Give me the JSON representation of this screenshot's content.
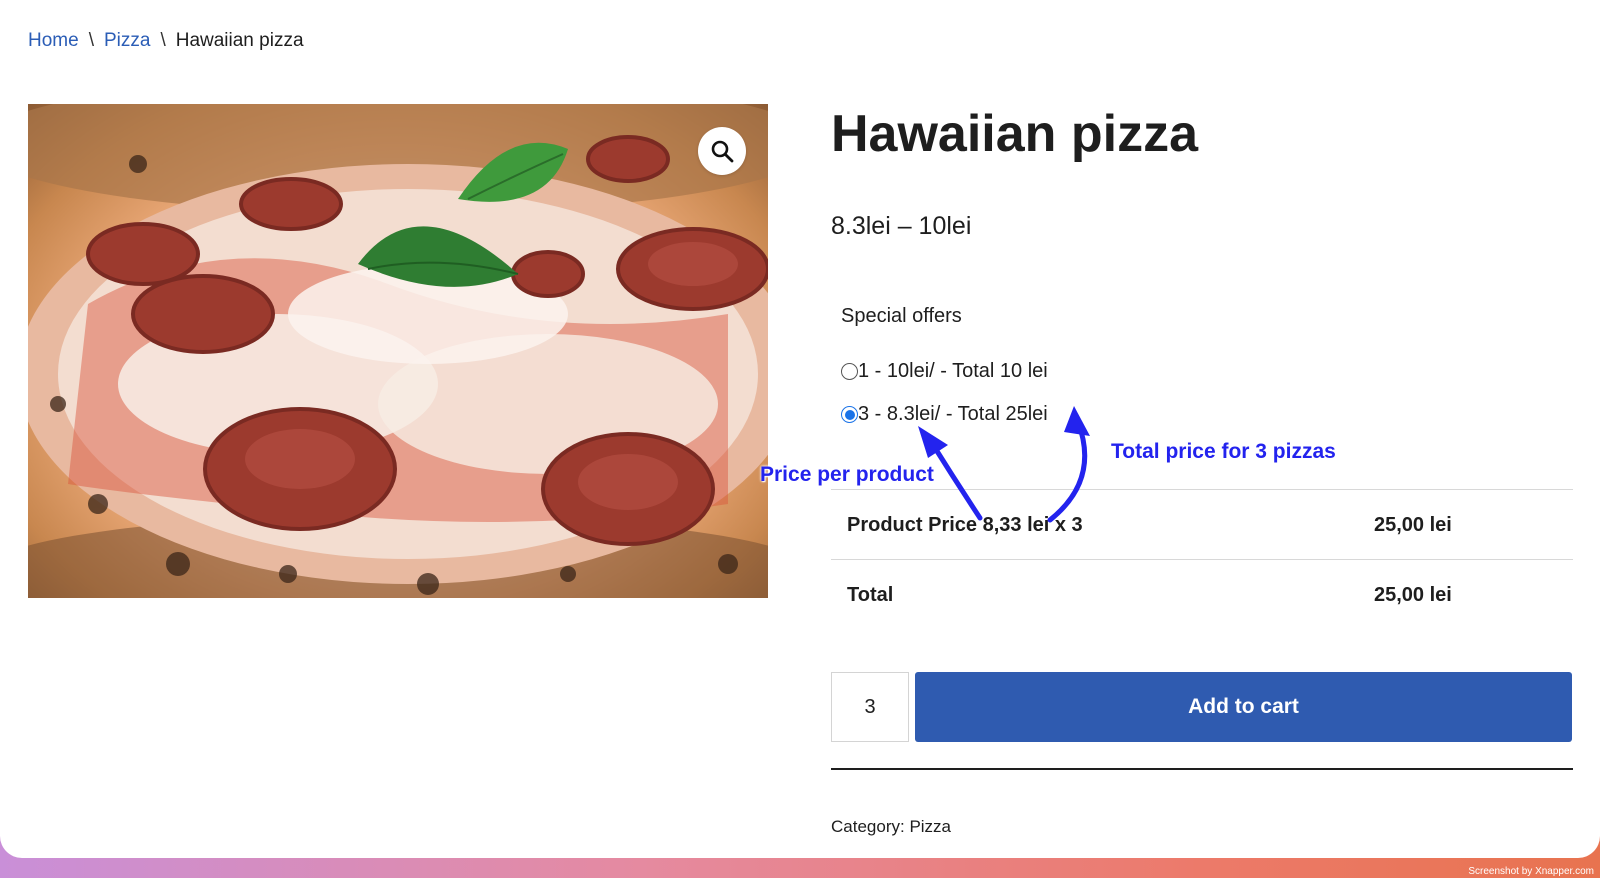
{
  "breadcrumb": {
    "home": "Home",
    "category": "Pizza",
    "current": "Hawaiian pizza",
    "separator": "\\"
  },
  "product": {
    "title": "Hawaiian pizza",
    "price_range": "8.3lei – 10lei",
    "image_alt_icon": "magnifier-icon"
  },
  "offers": {
    "label": "Special offers",
    "items": [
      {
        "text": "1 - 10lei/ - Total 10 lei",
        "selected": false
      },
      {
        "text": "3 - 8.3lei/ - Total 25lei",
        "selected": true
      }
    ]
  },
  "summary": {
    "product_price_label": "Product Price 8,33 lei x 3",
    "product_price_value": "25,00 lei",
    "total_label": "Total",
    "total_value": "25,00 lei"
  },
  "cart": {
    "quantity": "3",
    "add_label": "Add to cart"
  },
  "meta": {
    "category_label": "Category:",
    "category_value": "Pizza"
  },
  "annotations": {
    "price_per_product": "Price per product",
    "total_price": "Total price for 3 pizzas",
    "color": "#2323ee"
  },
  "watermark": "Screenshot by Xnapper.com",
  "colors": {
    "accent": "#2f5bb0",
    "link": "#2b5db6",
    "radio": "#1a73e8"
  }
}
